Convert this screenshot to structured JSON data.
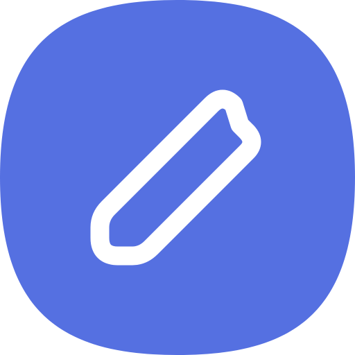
{
  "icon": {
    "name": "pencil-edit-icon",
    "background_color": "#5570E1",
    "glyph_color": "#FFFFFF"
  }
}
